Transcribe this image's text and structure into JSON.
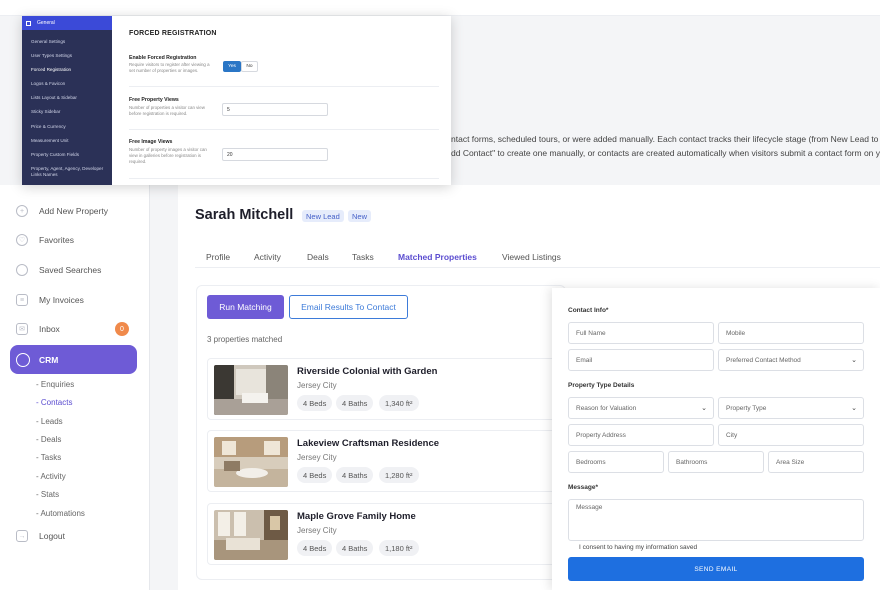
{
  "intro": {
    "line1": "ntact forms, scheduled tours, or were added manually. Each contact tracks their lifecycle stage (from New Lead to Closed)",
    "line2": "dd Contact\" to create one manually, or contacts are created automatically when visitors submit a contact form on your sit"
  },
  "sidebar": {
    "items": [
      {
        "label": "Add New Property",
        "icon": "plus-circle-icon"
      },
      {
        "label": "Favorites",
        "icon": "heart-icon"
      },
      {
        "label": "Saved Searches",
        "icon": "search-icon"
      },
      {
        "label": "My Invoices",
        "icon": "invoice-icon"
      },
      {
        "label": "Inbox",
        "icon": "mail-icon",
        "badge": "0"
      },
      {
        "label": "CRM",
        "icon": "crm-icon"
      },
      {
        "label": "Logout",
        "icon": "logout-icon"
      }
    ],
    "crm_sub": [
      "- Enquiries",
      "- Contacts",
      "- Leads",
      "- Deals",
      "- Tasks",
      "- Activity",
      "- Stats",
      "- Automations"
    ]
  },
  "contact": {
    "name": "Sarah Mitchell",
    "stage_badge": "New Lead",
    "status_badge": "New"
  },
  "tabs": [
    "Profile",
    "Activity",
    "Deals",
    "Tasks",
    "Matched Properties",
    "Viewed Listings"
  ],
  "matching": {
    "run_label": "Run Matching",
    "email_label": "Email Results To Contact",
    "count_text": "3 properties matched"
  },
  "properties": [
    {
      "title": "Riverside Colonial with Garden",
      "city": "Jersey City",
      "beds": "4 Beds",
      "baths": "4 Baths",
      "area": "1,340 ft²"
    },
    {
      "title": "Lakeview Craftsman Residence",
      "city": "Jersey City",
      "beds": "4 Beds",
      "baths": "4 Baths",
      "area": "1,280 ft²"
    },
    {
      "title": "Maple Grove Family Home",
      "city": "Jersey City",
      "beds": "4 Beds",
      "baths": "4 Baths",
      "area": "1,180 ft²"
    }
  ],
  "form": {
    "contact_info_label": "Contact Info*",
    "full_name": "Full Name",
    "mobile": "Mobile",
    "email": "Email",
    "preferred_method": "Preferred Contact Method",
    "property_type_label": "Property Type Details",
    "reason": "Reason for Valuation",
    "property_type": "Property Type",
    "address": "Property Address",
    "city": "City",
    "bedrooms": "Bedrooms",
    "bathrooms": "Bathrooms",
    "area_size": "Area Size",
    "message_label": "Message*",
    "message_placeholder": "Message",
    "consent": "I consent to having my information saved",
    "send": "SEND EMAIL"
  },
  "settings": {
    "header": "General",
    "menu": [
      "General Settings",
      "User Types Settings",
      "Forced Registration",
      "Logos & Favicon",
      "Lists Layout & Sidebar",
      "Sticky Sidebar",
      "Price & Currency",
      "Measurement Unit",
      "Property Custom Fields",
      "Property, Agent, Agency, Developer Links Names"
    ],
    "title": "FORCED REGISTRATION",
    "enable_label": "Enable Forced Registration",
    "enable_desc": "Require visitors to register after viewing a set number of properties or images.",
    "yes": "Yes",
    "no": "No",
    "prop_views_label": "Free Property Views",
    "prop_views_desc": "Number of properties a visitor can view before registration is required.",
    "prop_views_value": "5",
    "image_views_label": "Free Image Views",
    "image_views_desc": "Number of property images a visitor can view in galleries before registration is required.",
    "image_views_value": "20"
  },
  "colors": {
    "accent": "#6e5bd6",
    "send_button": "#1e6fe0",
    "badge": "#f08a4b",
    "settings_sidebar": "#2b3157"
  }
}
